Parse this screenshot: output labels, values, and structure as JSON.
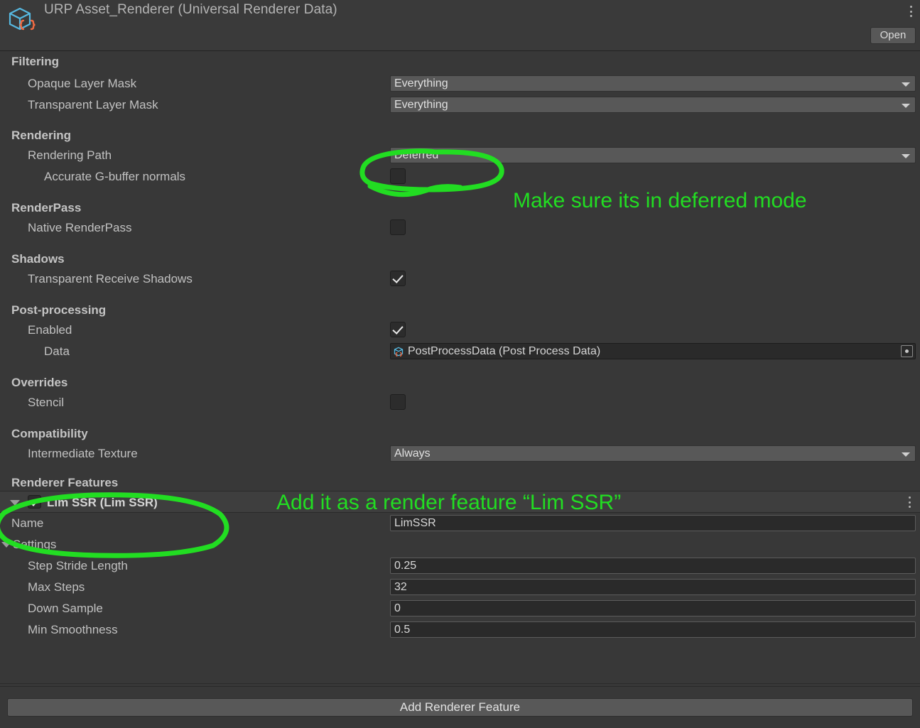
{
  "header": {
    "title": "URP Asset_Renderer (Universal Renderer Data)",
    "icon": "scriptable-object-asset-icon",
    "open_label": "Open",
    "menu_icon": "kebab-menu-icon"
  },
  "sections": [
    {
      "name": "Filtering",
      "rows": [
        {
          "label": "Opaque Layer Mask",
          "indent": 1,
          "control": "popup",
          "value": "Everything"
        },
        {
          "label": "Transparent Layer Mask",
          "indent": 1,
          "control": "popup",
          "value": "Everything"
        }
      ]
    },
    {
      "name": "Rendering",
      "rows": [
        {
          "label": "Rendering Path",
          "indent": 1,
          "control": "popup",
          "value": "Deferred"
        },
        {
          "label": "Accurate G-buffer normals",
          "indent": 2,
          "control": "checkbox",
          "value": false
        }
      ]
    },
    {
      "name": "RenderPass",
      "rows": [
        {
          "label": "Native RenderPass",
          "indent": 1,
          "control": "checkbox",
          "value": false
        }
      ]
    },
    {
      "name": "Shadows",
      "rows": [
        {
          "label": "Transparent Receive Shadows",
          "indent": 1,
          "control": "checkbox",
          "value": true
        }
      ]
    },
    {
      "name": "Post-processing",
      "rows": [
        {
          "label": "Enabled",
          "indent": 1,
          "control": "checkbox",
          "value": true
        },
        {
          "label": "Data",
          "indent": 2,
          "control": "object",
          "value": "PostProcessData (Post Process Data)"
        }
      ]
    },
    {
      "name": "Overrides",
      "rows": [
        {
          "label": "Stencil",
          "indent": 1,
          "control": "checkbox",
          "value": false
        }
      ]
    },
    {
      "name": "Compatibility",
      "rows": [
        {
          "label": "Intermediate Texture",
          "indent": 1,
          "control": "popup",
          "value": "Always"
        }
      ]
    }
  ],
  "renderer_features": {
    "section_title": "Renderer Features",
    "feature": {
      "title": "Lim SSR (Lim SSR)",
      "enabled": true,
      "expanded": true,
      "menu_icon": "kebab-menu-icon",
      "name_label": "Name",
      "name_value": "LimSSR",
      "settings_label": "Settings",
      "settings": [
        {
          "label": "Step Stride Length",
          "value": "0.25"
        },
        {
          "label": "Max Steps",
          "value": "32"
        },
        {
          "label": "Down Sample",
          "value": "0"
        },
        {
          "label": "Min Smoothness",
          "value": "0.5"
        }
      ]
    },
    "add_button_label": "Add Renderer Feature"
  },
  "annotations": {
    "color": "#22dd22",
    "note_deferred": "Make sure its in deferred mode",
    "note_feature": "Add it as a render feature “Lim SSR”"
  }
}
